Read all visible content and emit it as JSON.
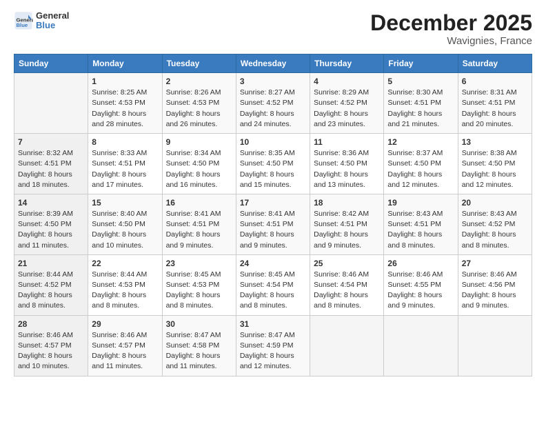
{
  "header": {
    "logo_general": "General",
    "logo_blue": "Blue",
    "title": "December 2025",
    "subtitle": "Wavignies, France"
  },
  "days_of_week": [
    "Sunday",
    "Monday",
    "Tuesday",
    "Wednesday",
    "Thursday",
    "Friday",
    "Saturday"
  ],
  "weeks": [
    [
      {
        "day": "",
        "content": ""
      },
      {
        "day": "1",
        "content": "Sunrise: 8:25 AM\nSunset: 4:53 PM\nDaylight: 8 hours\nand 28 minutes."
      },
      {
        "day": "2",
        "content": "Sunrise: 8:26 AM\nSunset: 4:53 PM\nDaylight: 8 hours\nand 26 minutes."
      },
      {
        "day": "3",
        "content": "Sunrise: 8:27 AM\nSunset: 4:52 PM\nDaylight: 8 hours\nand 24 minutes."
      },
      {
        "day": "4",
        "content": "Sunrise: 8:29 AM\nSunset: 4:52 PM\nDaylight: 8 hours\nand 23 minutes."
      },
      {
        "day": "5",
        "content": "Sunrise: 8:30 AM\nSunset: 4:51 PM\nDaylight: 8 hours\nand 21 minutes."
      },
      {
        "day": "6",
        "content": "Sunrise: 8:31 AM\nSunset: 4:51 PM\nDaylight: 8 hours\nand 20 minutes."
      }
    ],
    [
      {
        "day": "7",
        "content": "Sunrise: 8:32 AM\nSunset: 4:51 PM\nDaylight: 8 hours\nand 18 minutes."
      },
      {
        "day": "8",
        "content": "Sunrise: 8:33 AM\nSunset: 4:51 PM\nDaylight: 8 hours\nand 17 minutes."
      },
      {
        "day": "9",
        "content": "Sunrise: 8:34 AM\nSunset: 4:50 PM\nDaylight: 8 hours\nand 16 minutes."
      },
      {
        "day": "10",
        "content": "Sunrise: 8:35 AM\nSunset: 4:50 PM\nDaylight: 8 hours\nand 15 minutes."
      },
      {
        "day": "11",
        "content": "Sunrise: 8:36 AM\nSunset: 4:50 PM\nDaylight: 8 hours\nand 13 minutes."
      },
      {
        "day": "12",
        "content": "Sunrise: 8:37 AM\nSunset: 4:50 PM\nDaylight: 8 hours\nand 12 minutes."
      },
      {
        "day": "13",
        "content": "Sunrise: 8:38 AM\nSunset: 4:50 PM\nDaylight: 8 hours\nand 12 minutes."
      }
    ],
    [
      {
        "day": "14",
        "content": "Sunrise: 8:39 AM\nSunset: 4:50 PM\nDaylight: 8 hours\nand 11 minutes."
      },
      {
        "day": "15",
        "content": "Sunrise: 8:40 AM\nSunset: 4:50 PM\nDaylight: 8 hours\nand 10 minutes."
      },
      {
        "day": "16",
        "content": "Sunrise: 8:41 AM\nSunset: 4:51 PM\nDaylight: 8 hours\nand 9 minutes."
      },
      {
        "day": "17",
        "content": "Sunrise: 8:41 AM\nSunset: 4:51 PM\nDaylight: 8 hours\nand 9 minutes."
      },
      {
        "day": "18",
        "content": "Sunrise: 8:42 AM\nSunset: 4:51 PM\nDaylight: 8 hours\nand 9 minutes."
      },
      {
        "day": "19",
        "content": "Sunrise: 8:43 AM\nSunset: 4:51 PM\nDaylight: 8 hours\nand 8 minutes."
      },
      {
        "day": "20",
        "content": "Sunrise: 8:43 AM\nSunset: 4:52 PM\nDaylight: 8 hours\nand 8 minutes."
      }
    ],
    [
      {
        "day": "21",
        "content": "Sunrise: 8:44 AM\nSunset: 4:52 PM\nDaylight: 8 hours\nand 8 minutes."
      },
      {
        "day": "22",
        "content": "Sunrise: 8:44 AM\nSunset: 4:53 PM\nDaylight: 8 hours\nand 8 minutes."
      },
      {
        "day": "23",
        "content": "Sunrise: 8:45 AM\nSunset: 4:53 PM\nDaylight: 8 hours\nand 8 minutes."
      },
      {
        "day": "24",
        "content": "Sunrise: 8:45 AM\nSunset: 4:54 PM\nDaylight: 8 hours\nand 8 minutes."
      },
      {
        "day": "25",
        "content": "Sunrise: 8:46 AM\nSunset: 4:54 PM\nDaylight: 8 hours\nand 8 minutes."
      },
      {
        "day": "26",
        "content": "Sunrise: 8:46 AM\nSunset: 4:55 PM\nDaylight: 8 hours\nand 9 minutes."
      },
      {
        "day": "27",
        "content": "Sunrise: 8:46 AM\nSunset: 4:56 PM\nDaylight: 8 hours\nand 9 minutes."
      }
    ],
    [
      {
        "day": "28",
        "content": "Sunrise: 8:46 AM\nSunset: 4:57 PM\nDaylight: 8 hours\nand 10 minutes."
      },
      {
        "day": "29",
        "content": "Sunrise: 8:46 AM\nSunset: 4:57 PM\nDaylight: 8 hours\nand 11 minutes."
      },
      {
        "day": "30",
        "content": "Sunrise: 8:47 AM\nSunset: 4:58 PM\nDaylight: 8 hours\nand 11 minutes."
      },
      {
        "day": "31",
        "content": "Sunrise: 8:47 AM\nSunset: 4:59 PM\nDaylight: 8 hours\nand 12 minutes."
      },
      {
        "day": "",
        "content": ""
      },
      {
        "day": "",
        "content": ""
      },
      {
        "day": "",
        "content": ""
      }
    ]
  ]
}
